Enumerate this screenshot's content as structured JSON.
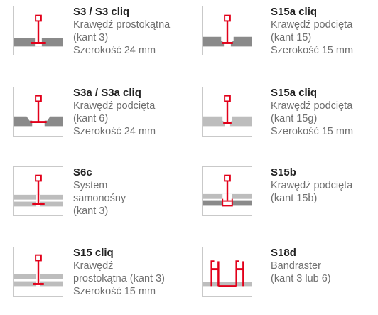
{
  "entries": [
    {
      "code": "S3 / S3 cliq",
      "lines": [
        "Krawędź prostokątna",
        "(kant 3)",
        "Szerokość 24 mm"
      ],
      "icon": "tile-edge-square-icon"
    },
    {
      "code": "S15a cliq",
      "lines": [
        "Krawędź podcięta",
        "(kant 15)",
        "Szerokość 15 mm"
      ],
      "icon": "tile-edge-rebated-icon"
    },
    {
      "code": "S3a / S3a cliq",
      "lines": [
        "Krawędź podcięta",
        "(kant 6)",
        "Szerokość 24 mm"
      ],
      "icon": "tile-edge-tegular-icon"
    },
    {
      "code": "S15a cliq",
      "lines": [
        "Krawędź podcięta",
        "(kant 15g)",
        "Szerokość 15 mm"
      ],
      "icon": "tile-edge-rebated-light-icon"
    },
    {
      "code": "S6c",
      "lines": [
        "System",
        "samonośny",
        "(kant 3)"
      ],
      "icon": "tile-edge-self-supporting-icon"
    },
    {
      "code": "S15b",
      "lines": [
        "Krawędź podcięta",
        "(kant 15b)"
      ],
      "icon": "tile-edge-concealed-icon"
    },
    {
      "code": "S15 cliq",
      "lines": [
        "Krawędź",
        "prostokątna (kant 3)",
        "Szerokość 15 mm"
      ],
      "icon": "tile-edge-narrow-icon"
    },
    {
      "code": "S18d",
      "lines": [
        "Bandraster",
        "(kant 3 lub 6)"
      ],
      "icon": "bandraster-profile-icon"
    }
  ],
  "colors": {
    "accent": "#e2001a",
    "tile_dark": "#8a8a8a",
    "tile_light": "#bdbdbd",
    "border": "#c9c9c9"
  }
}
